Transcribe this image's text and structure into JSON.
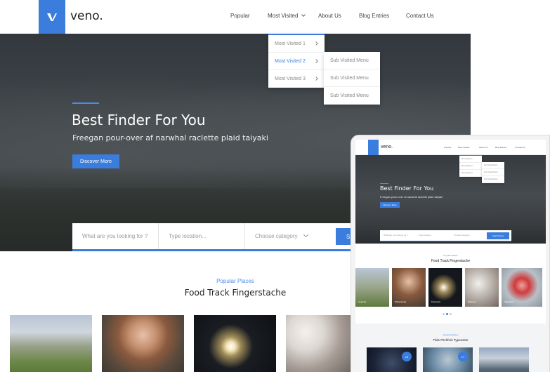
{
  "brand": {
    "name": "veno.",
    "accent": "#3b7ddd"
  },
  "nav": {
    "items": [
      "Popular",
      "Most Visited",
      "About Us",
      "Blog Entries",
      "Contact Us"
    ]
  },
  "dropdown": {
    "items": [
      "Most Visited 1",
      "Most Visited 2",
      "Most Visited 3"
    ],
    "active_index": 1,
    "submenu": [
      "Sub Visited Menu",
      "Sub Visited Menu",
      "Sub Visited Menu"
    ]
  },
  "hero": {
    "title": "Best Finder For You",
    "subtitle": "Freegan pour-over af narwhal raclette plaid taiyaki",
    "cta": "Discover More"
  },
  "search": {
    "keyword_placeholder": "What are you looking for ?",
    "location_placeholder": "Type location...",
    "category_placeholder": "Choose category",
    "button_label": "S"
  },
  "popular": {
    "kicker": "Popular Places",
    "title": "Food Track Fingerstache"
  },
  "mobile": {
    "brand": "veno.",
    "nav": [
      "Popular",
      "Most Visited",
      "About Us",
      "Blog Entries",
      "Contact Us"
    ],
    "dropdown": [
      "Most Visited 1",
      "Most Visited 2",
      "Most Visited 3"
    ],
    "submenu": [
      "Sub Visited Menu",
      "Sub Visited Menu",
      "Sub Visited Menu"
    ],
    "hero_title": "Best Finder For You",
    "hero_subtitle": "Freegan pour-over af narwhal raclette plaid taiyaki",
    "hero_cta": "Discover More",
    "search_keyword": "What are you looking for ?",
    "search_location": "Type location...",
    "search_category": "Choose category",
    "search_button": "Search Now",
    "popular_kicker": "Popular Places",
    "popular_title": "Food Track Fingerstache",
    "cards": [
      "Coloring",
      "Wintersburg",
      "Fireworks",
      "Bachelor",
      "Shanghai"
    ],
    "featured_kicker": "Featured Places",
    "featured_title": "Tilde Pitchfork Typewriter",
    "featured_badges": [
      "13",
      "17",
      ""
    ]
  },
  "icons": [
    "veno-logo-icon",
    "chevron-down-icon",
    "chevron-right-icon"
  ]
}
